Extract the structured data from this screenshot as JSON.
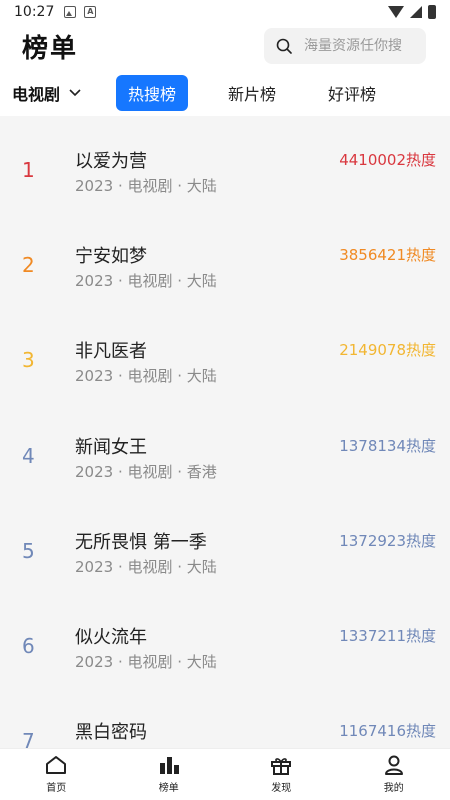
{
  "status_bar": {
    "time": "10:27"
  },
  "header": {
    "title": "榜单",
    "search_placeholder": "海量资源任你搜"
  },
  "filter": {
    "category": "电视剧",
    "tabs": [
      {
        "label": "热搜榜",
        "active": true
      },
      {
        "label": "新片榜",
        "active": false
      },
      {
        "label": "好评榜",
        "active": false
      }
    ]
  },
  "colors": {
    "accent": "#1677ff",
    "rank_1": "#d9383f",
    "rank_2": "#f08a24",
    "rank_3": "#f2b632",
    "rank_other": "#7088b8"
  },
  "list": [
    {
      "rank": "1",
      "title": "以爱为营",
      "meta": "2023 · 电视剧 · 大陆",
      "heat": "4410002热度"
    },
    {
      "rank": "2",
      "title": "宁安如梦",
      "meta": "2023 · 电视剧 · 大陆",
      "heat": "3856421热度"
    },
    {
      "rank": "3",
      "title": "非凡医者",
      "meta": "2023 · 电视剧 · 大陆",
      "heat": "2149078热度"
    },
    {
      "rank": "4",
      "title": "新闻女王",
      "meta": "2023 · 电视剧 · 香港",
      "heat": "1378134热度"
    },
    {
      "rank": "5",
      "title": "无所畏惧 第一季",
      "meta": "2023 · 电视剧 · 大陆",
      "heat": "1372923热度"
    },
    {
      "rank": "6",
      "title": "似火流年",
      "meta": "2023 · 电视剧 · 大陆",
      "heat": "1337211热度"
    },
    {
      "rank": "7",
      "title": "黑白密码",
      "meta": "",
      "heat": "1167416热度"
    }
  ],
  "bottom_nav": [
    {
      "label": "首页",
      "icon": "home-icon"
    },
    {
      "label": "榜单",
      "icon": "chart-icon"
    },
    {
      "label": "发现",
      "icon": "gift-icon"
    },
    {
      "label": "我的",
      "icon": "user-icon"
    }
  ]
}
